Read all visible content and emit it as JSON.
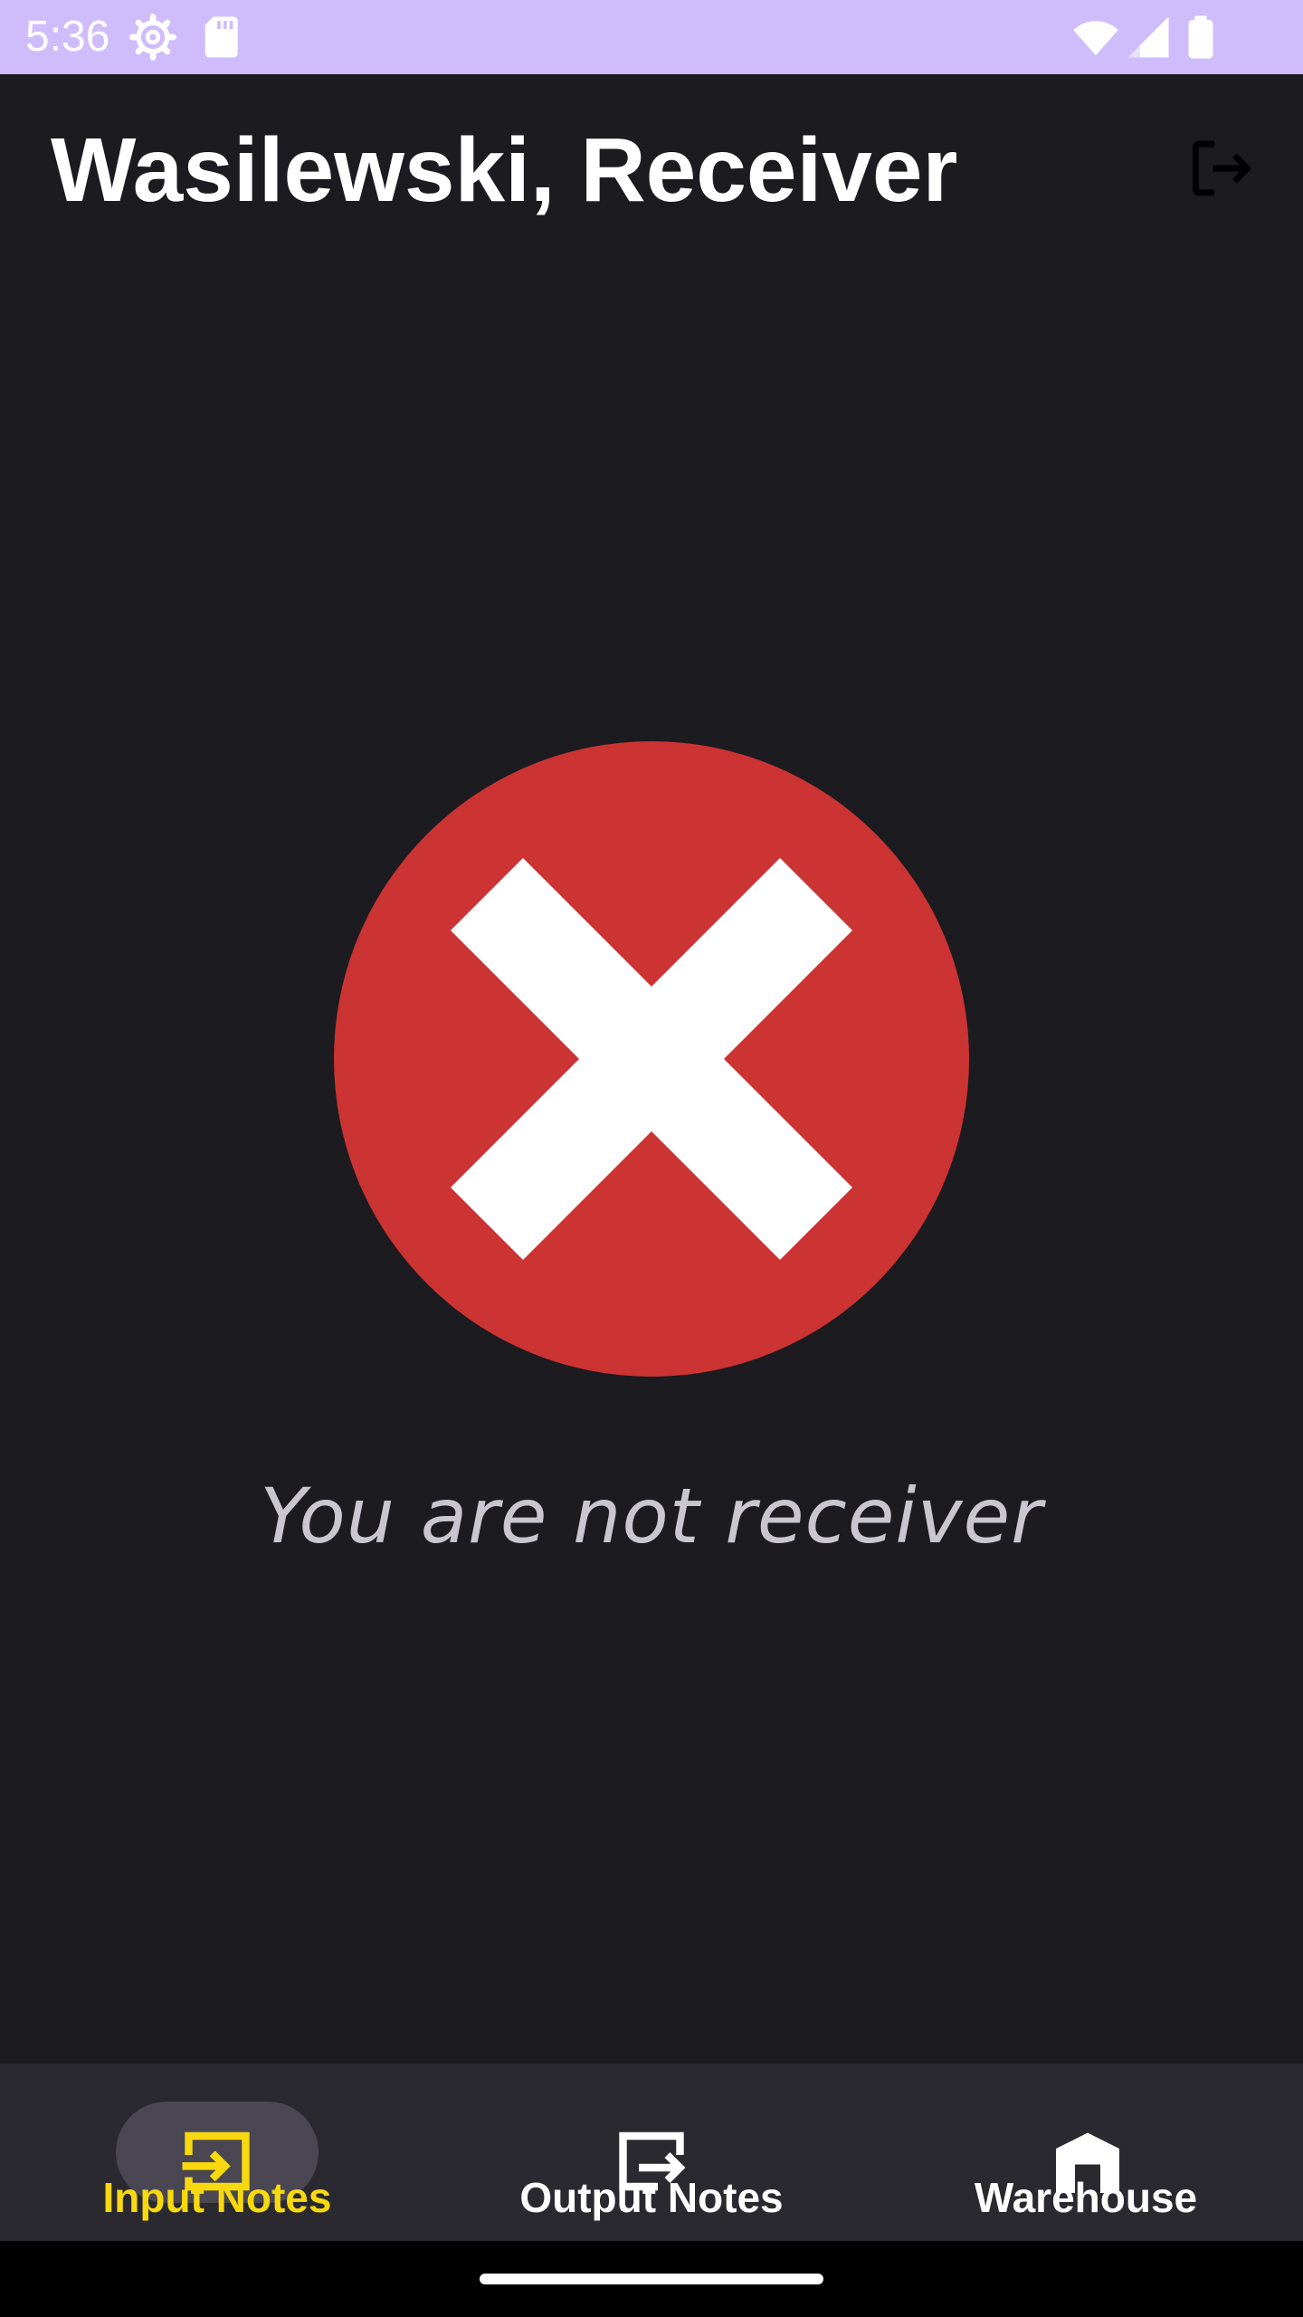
{
  "status_bar": {
    "time": "5:36",
    "icons": [
      "settings-gear-icon",
      "sd-card-icon",
      "wifi-icon",
      "cell-signal-icon",
      "battery-icon"
    ]
  },
  "app_bar": {
    "title": "Wasilewski, Receiver",
    "action_icon": "logout-icon"
  },
  "error": {
    "icon": "error-x-circle-icon",
    "message": "You are not receiver",
    "colors": {
      "circle": "#cc3333",
      "cross": "#ffffff"
    }
  },
  "bottom_nav": {
    "items": [
      {
        "label": "Input Notes",
        "icon": "input-notes-icon",
        "active": true
      },
      {
        "label": "Output Notes",
        "icon": "output-notes-icon",
        "active": false
      },
      {
        "label": "Warehouse",
        "icon": "warehouse-icon",
        "active": false
      }
    ],
    "active_color": "#f8d90f"
  },
  "colors": {
    "background": "#1c1b20",
    "status_bar": "#cfbdfb",
    "nav_background": "#2a2930"
  }
}
